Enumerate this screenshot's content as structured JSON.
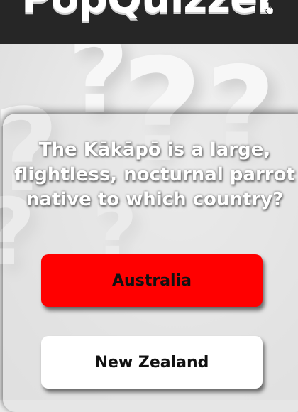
{
  "header": {
    "logo_text": "PopQuizzer"
  },
  "quiz": {
    "question": "The Kākāpō is a large, flightless, nocturnal parrot native to which country?",
    "answers": [
      {
        "label": "Australia",
        "color": "#ff0000"
      },
      {
        "label": "New Zealand",
        "color": "#ffffff"
      }
    ]
  },
  "colors": {
    "header_bg": "#262626",
    "page_bg": "#ebebeb"
  },
  "icons": {
    "cursor": "hand-pointer-icon",
    "background": "question-mark-pattern"
  }
}
